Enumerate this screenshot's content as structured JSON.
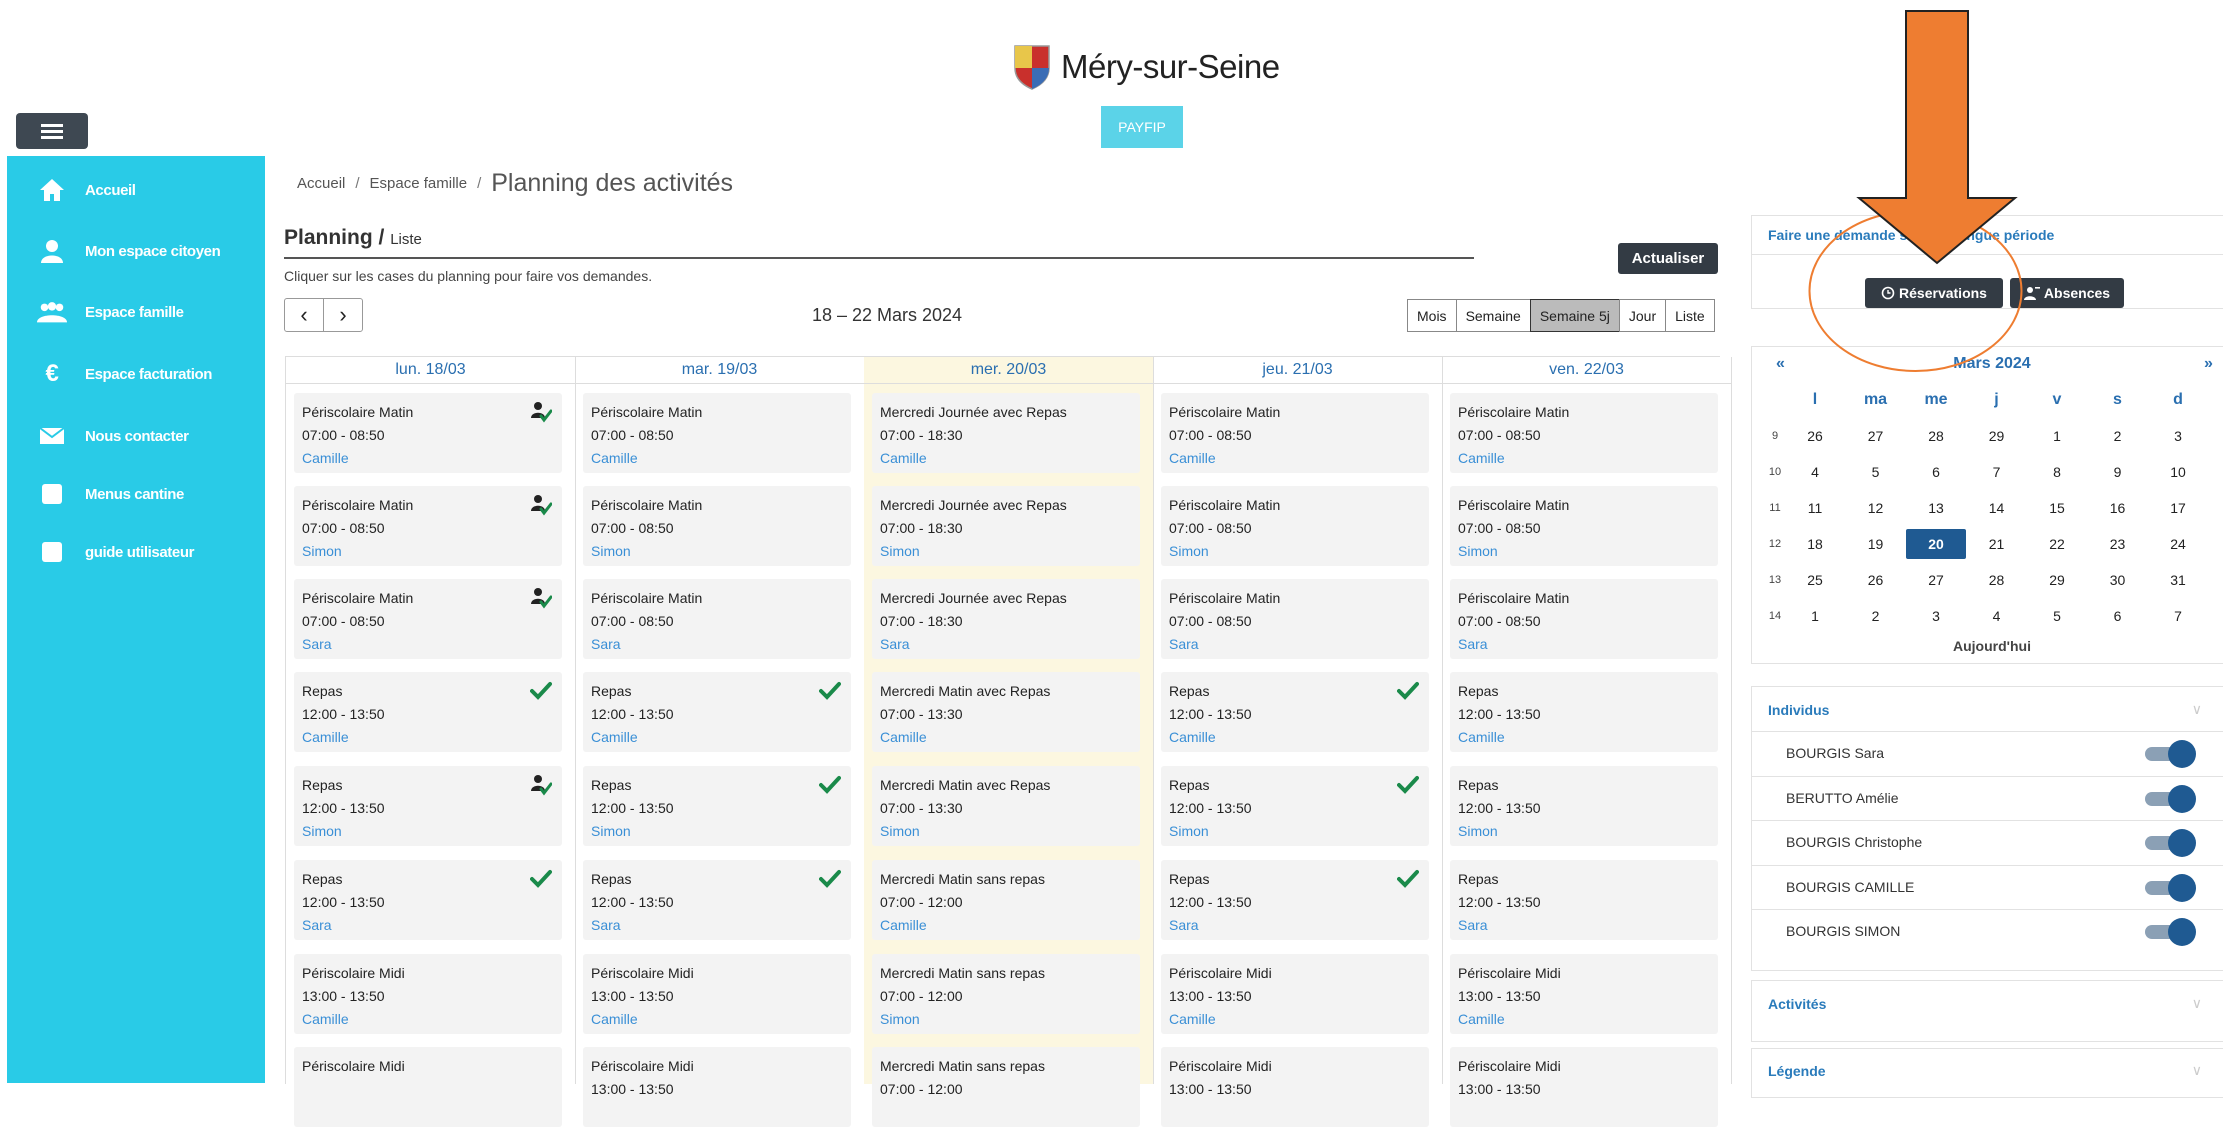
{
  "header": {
    "brand": "Méry-sur-Seine",
    "payfip": "PAYFIP"
  },
  "sidebar": {
    "items": [
      {
        "label": "Accueil",
        "icon": "home-icon"
      },
      {
        "label": "Mon espace citoyen",
        "icon": "user-icon"
      },
      {
        "label": "Espace famille",
        "icon": "family-icon"
      },
      {
        "label": "Espace facturation",
        "icon": "euro-icon"
      },
      {
        "label": "Nous contacter",
        "icon": "envelope-icon"
      },
      {
        "label": "Menus cantine",
        "icon": "square-icon"
      },
      {
        "label": "guide utilisateur",
        "icon": "square-icon"
      }
    ]
  },
  "breadcrumb": {
    "home": "Accueil",
    "sep": "/",
    "family": "Espace famille",
    "current": "Planning des activités"
  },
  "planning": {
    "title": "Planning",
    "sep": "/",
    "subtitle": "Liste",
    "refresh": "Actualiser",
    "hint": "Cliquer sur les cases du planning pour faire vos demandes.",
    "prev": "‹",
    "next": "›",
    "range": "18 – 22 Mars 2024",
    "views": [
      "Mois",
      "Semaine",
      "Semaine 5j",
      "Jour",
      "Liste"
    ],
    "active_view": "Semaine 5j"
  },
  "days": [
    {
      "label": "lun. 18/03",
      "today": false,
      "events": [
        {
          "title": "Périscolaire Matin",
          "time": "07:00 - 08:50",
          "name": "Camille",
          "badge": "user-check-icon"
        },
        {
          "title": "Périscolaire Matin",
          "time": "07:00 - 08:50",
          "name": "Simon",
          "badge": "user-check-icon"
        },
        {
          "title": "Périscolaire Matin",
          "time": "07:00 - 08:50",
          "name": "Sara",
          "badge": "user-check-icon"
        },
        {
          "title": "Repas",
          "time": "12:00 - 13:50",
          "name": "Camille",
          "badge": "check-icon"
        },
        {
          "title": "Repas",
          "time": "12:00 - 13:50",
          "name": "Simon",
          "badge": "user-check-icon"
        },
        {
          "title": "Repas",
          "time": "12:00 - 13:50",
          "name": "Sara",
          "badge": "check-icon"
        },
        {
          "title": "Périscolaire Midi",
          "time": "13:00 - 13:50",
          "name": "Camille",
          "badge": ""
        },
        {
          "title": "Périscolaire Midi",
          "time": "",
          "name": "",
          "badge": ""
        }
      ]
    },
    {
      "label": "mar. 19/03",
      "today": false,
      "events": [
        {
          "title": "Périscolaire Matin",
          "time": "07:00 - 08:50",
          "name": "Camille",
          "badge": ""
        },
        {
          "title": "Périscolaire Matin",
          "time": "07:00 - 08:50",
          "name": "Simon",
          "badge": ""
        },
        {
          "title": "Périscolaire Matin",
          "time": "07:00 - 08:50",
          "name": "Sara",
          "badge": ""
        },
        {
          "title": "Repas",
          "time": "12:00 - 13:50",
          "name": "Camille",
          "badge": "check-icon"
        },
        {
          "title": "Repas",
          "time": "12:00 - 13:50",
          "name": "Simon",
          "badge": "check-icon"
        },
        {
          "title": "Repas",
          "time": "12:00 - 13:50",
          "name": "Sara",
          "badge": "check-icon"
        },
        {
          "title": "Périscolaire Midi",
          "time": "13:00 - 13:50",
          "name": "Camille",
          "badge": ""
        },
        {
          "title": "Périscolaire Midi",
          "time": "13:00 - 13:50",
          "name": "",
          "badge": ""
        }
      ]
    },
    {
      "label": "mer. 20/03",
      "today": true,
      "events": [
        {
          "title": "Mercredi Journée avec Repas",
          "time": "07:00 - 18:30",
          "name": "Camille",
          "badge": ""
        },
        {
          "title": "Mercredi Journée avec Repas",
          "time": "07:00 - 18:30",
          "name": "Simon",
          "badge": ""
        },
        {
          "title": "Mercredi Journée avec Repas",
          "time": "07:00 - 18:30",
          "name": "Sara",
          "badge": ""
        },
        {
          "title": "Mercredi Matin avec Repas",
          "time": "07:00 - 13:30",
          "name": "Camille",
          "badge": ""
        },
        {
          "title": "Mercredi Matin avec Repas",
          "time": "07:00 - 13:30",
          "name": "Simon",
          "badge": ""
        },
        {
          "title": "Mercredi Matin sans repas",
          "time": "07:00 - 12:00",
          "name": "Camille",
          "badge": ""
        },
        {
          "title": "Mercredi Matin sans repas",
          "time": "07:00 - 12:00",
          "name": "Simon",
          "badge": ""
        },
        {
          "title": "Mercredi Matin sans repas",
          "time": "07:00 - 12:00",
          "name": "",
          "badge": ""
        }
      ]
    },
    {
      "label": "jeu. 21/03",
      "today": false,
      "events": [
        {
          "title": "Périscolaire Matin",
          "time": "07:00 - 08:50",
          "name": "Camille",
          "badge": ""
        },
        {
          "title": "Périscolaire Matin",
          "time": "07:00 - 08:50",
          "name": "Simon",
          "badge": ""
        },
        {
          "title": "Périscolaire Matin",
          "time": "07:00 - 08:50",
          "name": "Sara",
          "badge": ""
        },
        {
          "title": "Repas",
          "time": "12:00 - 13:50",
          "name": "Camille",
          "badge": "check-icon"
        },
        {
          "title": "Repas",
          "time": "12:00 - 13:50",
          "name": "Simon",
          "badge": "check-icon"
        },
        {
          "title": "Repas",
          "time": "12:00 - 13:50",
          "name": "Sara",
          "badge": "check-icon"
        },
        {
          "title": "Périscolaire Midi",
          "time": "13:00 - 13:50",
          "name": "Camille",
          "badge": ""
        },
        {
          "title": "Périscolaire Midi",
          "time": "13:00 - 13:50",
          "name": "",
          "badge": ""
        }
      ]
    },
    {
      "label": "ven. 22/03",
      "today": false,
      "events": [
        {
          "title": "Périscolaire Matin",
          "time": "07:00 - 08:50",
          "name": "Camille",
          "badge": ""
        },
        {
          "title": "Périscolaire Matin",
          "time": "07:00 - 08:50",
          "name": "Simon",
          "badge": ""
        },
        {
          "title": "Périscolaire Matin",
          "time": "07:00 - 08:50",
          "name": "Sara",
          "badge": ""
        },
        {
          "title": "Repas",
          "time": "12:00 - 13:50",
          "name": "Camille",
          "badge": ""
        },
        {
          "title": "Repas",
          "time": "12:00 - 13:50",
          "name": "Simon",
          "badge": ""
        },
        {
          "title": "Repas",
          "time": "12:00 - 13:50",
          "name": "Sara",
          "badge": ""
        },
        {
          "title": "Périscolaire Midi",
          "time": "13:00 - 13:50",
          "name": "Camille",
          "badge": ""
        },
        {
          "title": "Périscolaire Midi",
          "time": "13:00 - 13:50",
          "name": "",
          "badge": ""
        }
      ]
    }
  ],
  "right": {
    "demand_title": "Faire une demande sur une longue période",
    "reservations": "Réservations",
    "absences": "Absences",
    "minical": {
      "prev": "«",
      "next": "»",
      "title": "Mars 2024",
      "weekdays": [
        "l",
        "ma",
        "me",
        "j",
        "v",
        "s",
        "d"
      ],
      "weeks": [
        {
          "wk": "9",
          "days": [
            "26",
            "27",
            "28",
            "29",
            "1",
            "2",
            "3"
          ]
        },
        {
          "wk": "10",
          "days": [
            "4",
            "5",
            "6",
            "7",
            "8",
            "9",
            "10"
          ]
        },
        {
          "wk": "11",
          "days": [
            "11",
            "12",
            "13",
            "14",
            "15",
            "16",
            "17"
          ]
        },
        {
          "wk": "12",
          "days": [
            "18",
            "19",
            "20",
            "21",
            "22",
            "23",
            "24"
          ]
        },
        {
          "wk": "13",
          "days": [
            "25",
            "26",
            "27",
            "28",
            "29",
            "30",
            "31"
          ]
        },
        {
          "wk": "14",
          "days": [
            "1",
            "2",
            "3",
            "4",
            "5",
            "6",
            "7"
          ]
        }
      ],
      "selected": "20",
      "today_label": "Aujourd'hui"
    },
    "individus_title": "Individus",
    "individus": [
      {
        "name": "BOURGIS Sara",
        "enabled": true
      },
      {
        "name": "BERUTTO Amélie",
        "enabled": true
      },
      {
        "name": "BOURGIS Christophe",
        "enabled": true
      },
      {
        "name": "BOURGIS CAMILLE",
        "enabled": true
      },
      {
        "name": "BOURGIS SIMON",
        "enabled": true
      }
    ],
    "activites_title": "Activités",
    "legende_title": "Légende",
    "chevron": "∨"
  },
  "colors": {
    "sidebar": "#29cbe7",
    "annotation": "#ee7d31",
    "check": "#1a8a4a",
    "link": "#3a8fd6",
    "heading": "#2a6fb0"
  }
}
